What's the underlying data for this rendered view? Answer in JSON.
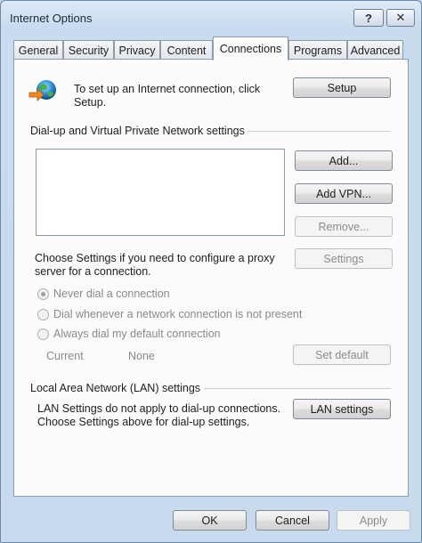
{
  "window": {
    "title": "Internet Options",
    "help_glyph": "?",
    "close_glyph": "✕"
  },
  "tabs": [
    {
      "label": "General"
    },
    {
      "label": "Security"
    },
    {
      "label": "Privacy"
    },
    {
      "label": "Content"
    },
    {
      "label": "Connections",
      "active": true
    },
    {
      "label": "Programs"
    },
    {
      "label": "Advanced"
    }
  ],
  "setup": {
    "text_line1": "To set up an Internet connection, click",
    "text_line2": "Setup.",
    "button": "Setup",
    "icon": "network-globe-icon"
  },
  "dialup": {
    "heading": "Dial-up and Virtual Private Network settings",
    "add": "Add...",
    "add_vpn": "Add VPN...",
    "remove": "Remove...",
    "proxy_line1": "Choose Settings if you need to configure a proxy",
    "proxy_line2": "server for a connection.",
    "settings": "Settings",
    "radios": [
      {
        "label": "Never dial a connection",
        "checked": true
      },
      {
        "label": "Dial whenever a network connection is not present",
        "checked": false
      },
      {
        "label": "Always dial my default connection",
        "checked": false
      }
    ],
    "current_label": "Current",
    "current_value": "None",
    "set_default": "Set default"
  },
  "lan": {
    "heading": "Local Area Network (LAN) settings",
    "line1": "LAN Settings do not apply to dial-up connections.",
    "line2": "Choose Settings above for dial-up settings.",
    "button": "LAN settings"
  },
  "footer": {
    "ok": "OK",
    "cancel": "Cancel",
    "apply": "Apply"
  }
}
